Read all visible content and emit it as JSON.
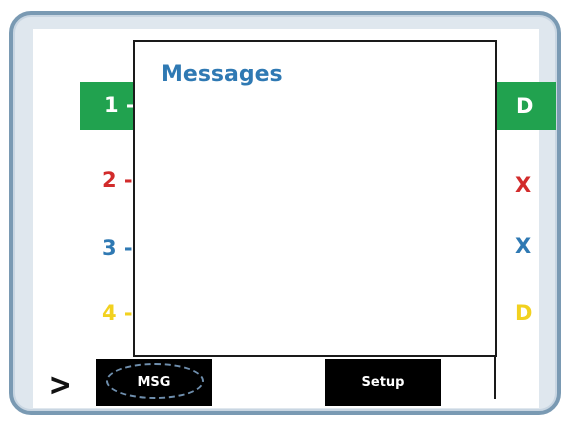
{
  "overlay": {
    "title": "Messages"
  },
  "lines": [
    {
      "number": "1 -",
      "status": "D",
      "color": "#ffffff",
      "status_color": "#ffffff",
      "highlight": "#21a24f"
    },
    {
      "number": "2 -",
      "status": "X",
      "color": "#d22b2b",
      "status_color": "#d22b2b"
    },
    {
      "number": "3 -",
      "status": "X",
      "color": "#2f79b3",
      "status_color": "#2f79b3"
    },
    {
      "number": "4 -",
      "status": "D",
      "color": "#f2d11f",
      "status_color": "#f2d11f"
    }
  ],
  "softkeys": {
    "prompt": ">",
    "msg": "MSG",
    "setup": "Setup"
  }
}
